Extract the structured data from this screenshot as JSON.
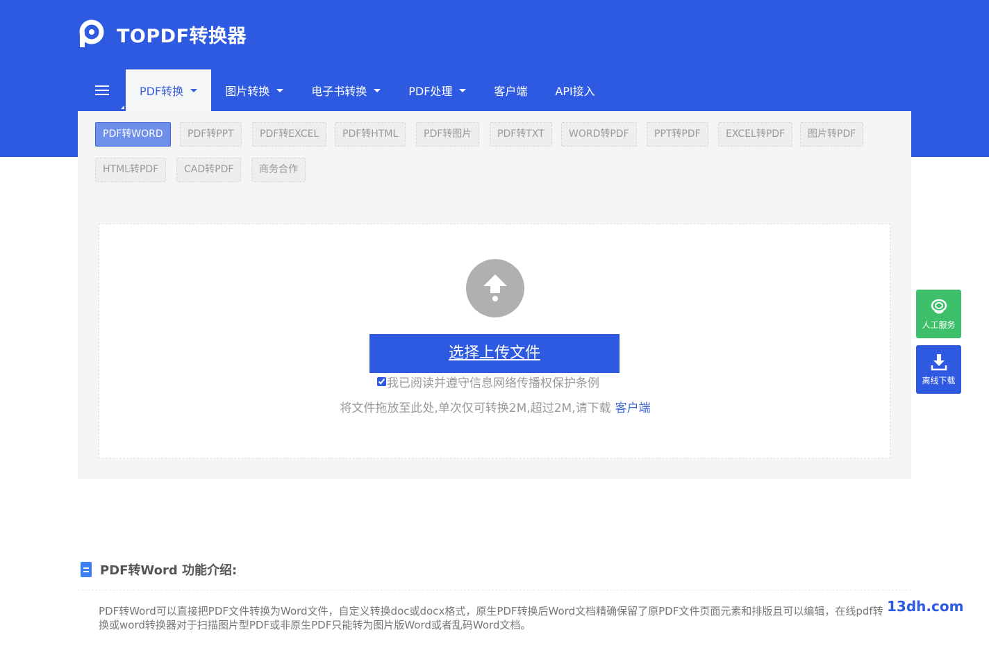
{
  "brand": {
    "name": "TOPDF转换器"
  },
  "nav": {
    "items": [
      {
        "label": "PDF转换",
        "dropdown": true,
        "active": true
      },
      {
        "label": "图片转换",
        "dropdown": true
      },
      {
        "label": "电子书转换",
        "dropdown": true
      },
      {
        "label": "PDF处理",
        "dropdown": true
      },
      {
        "label": "客户端",
        "dropdown": false
      },
      {
        "label": "API接入",
        "dropdown": false
      }
    ]
  },
  "tags": [
    "PDF转WORD",
    "PDF转PPT",
    "PDF转EXCEL",
    "PDF转HTML",
    "PDF转图片",
    "PDF转TXT",
    "WORD转PDF",
    "PPT转PDF",
    "EXCEL转PDF",
    "图片转PDF",
    "HTML转PDF",
    "CAD转PDF",
    "商务合作"
  ],
  "active_tag": "PDF转WORD",
  "upload": {
    "button_label": "选择上传文件",
    "agree_label": "我已阅读并遵守信息网络传播权保护条例",
    "agree_checked": true,
    "hint": "将文件拖放至此处,单次仅可转换2M,超过2M,请下载",
    "hint_link": "客户端"
  },
  "side": {
    "service_label": "人工服务",
    "download_label": "离线下载"
  },
  "intro": {
    "title": "PDF转Word 功能介绍:",
    "text": "PDF转Word可以直接把PDF文件转换为Word文件，自定义转换doc或docx格式，原生PDF转换后Word文档精确保留了原PDF文件页面元素和排版且可以编辑，在线pdf转换或word转换器对于扫描图片型PDF或非原生PDF只能转为图片版Word或者乱码Word文档。"
  },
  "watermark": "13dh.com",
  "colors": {
    "primary": "#2e5ae2",
    "service_green": "#3ec06b",
    "panel_bg": "#f5f5f5"
  },
  "icons": [
    "logo-p-icon",
    "menu-icon",
    "chevron-down-icon",
    "upload-arrow-icon",
    "headset-icon",
    "download-icon",
    "document-icon"
  ]
}
